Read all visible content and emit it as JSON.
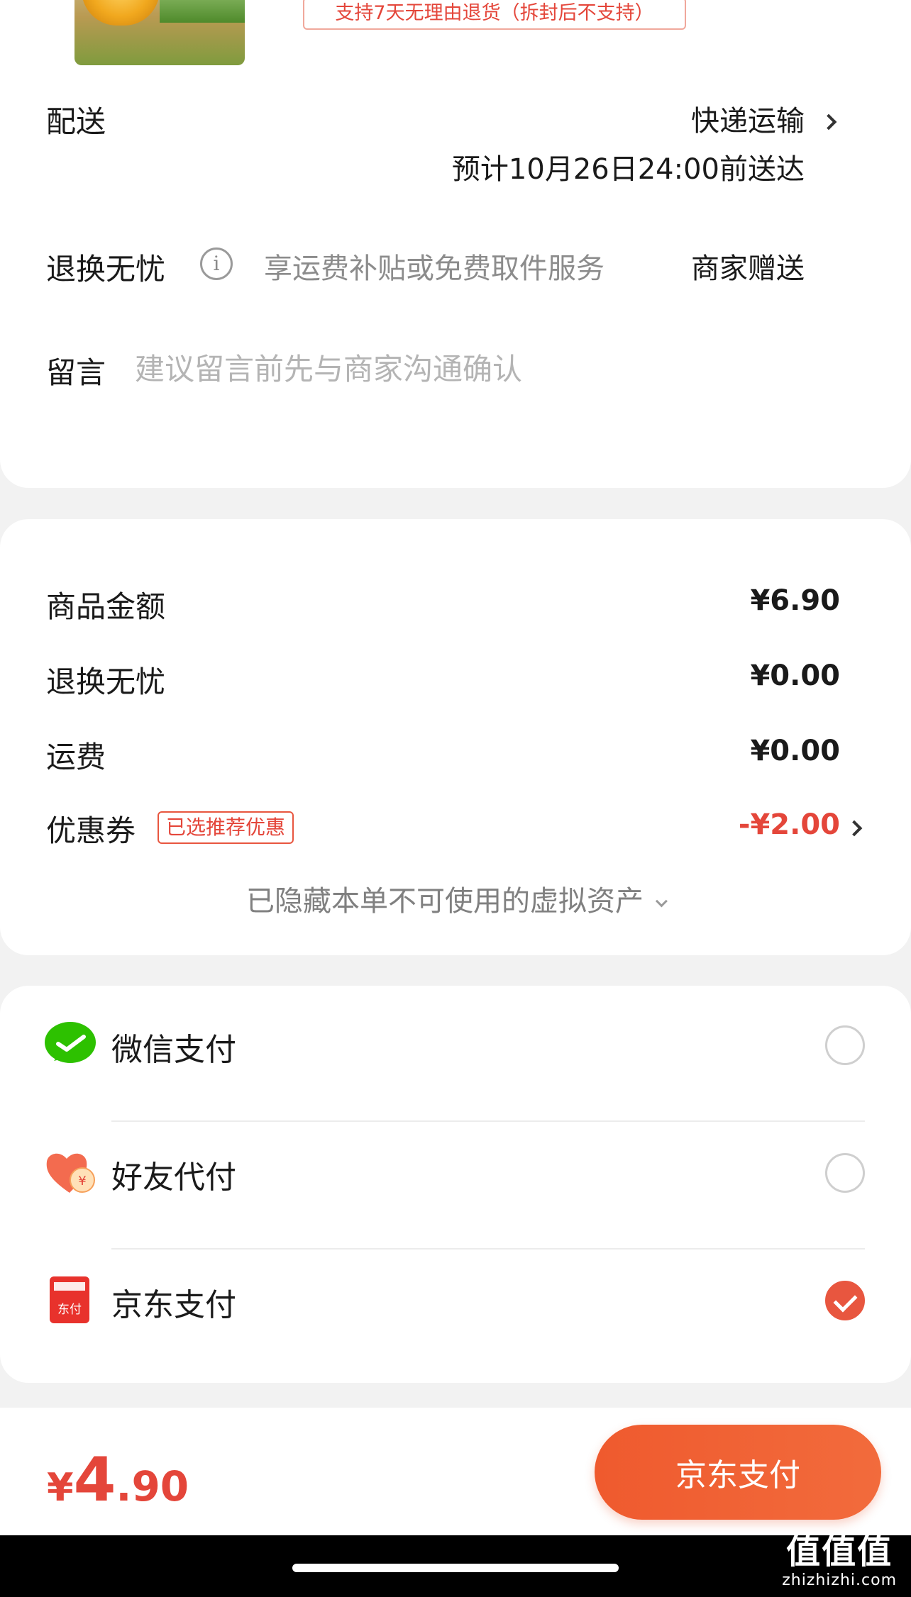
{
  "product": {
    "return_policy_tag": "支持7天无理由退货（拆封后不支持）"
  },
  "delivery": {
    "label": "配送",
    "method": "快递运输",
    "eta": "预计10月26日24:00前送达"
  },
  "return_worry_free": {
    "label": "退换无忧",
    "desc": "享运费补贴或免费取件服务",
    "provider": "商家赠送"
  },
  "message": {
    "label": "留言",
    "placeholder": "建议留言前先与商家沟通确认",
    "value": ""
  },
  "price_summary": {
    "rows": [
      {
        "label": "商品金额",
        "amount": "¥6.90"
      },
      {
        "label": "退换无忧",
        "amount": "¥0.00"
      },
      {
        "label": "运费",
        "amount": "¥0.00"
      }
    ],
    "coupon": {
      "label": "优惠券",
      "tag": "已选推荐优惠",
      "amount": "-¥2.00"
    },
    "hidden_assets": "已隐藏本单不可使用的虚拟资产"
  },
  "payment_methods": [
    {
      "label": "微信支付",
      "icon": "wechat-pay-icon",
      "selected": false
    },
    {
      "label": "好友代付",
      "icon": "friend-pay-icon",
      "selected": false,
      "icon_text": "¥"
    },
    {
      "label": "京东支付",
      "icon": "jd-pay-icon",
      "selected": true,
      "icon_text": "东付"
    }
  ],
  "footer": {
    "total_symbol": "¥",
    "total_int": "4",
    "total_dec": ".90",
    "pay_button": "京东支付"
  },
  "watermark": {
    "big": "值值值",
    "small": "zhizhizhi.com"
  },
  "colors": {
    "accent": "#e4463a",
    "wechat": "#2dc100",
    "background": "#f2f2f2"
  }
}
